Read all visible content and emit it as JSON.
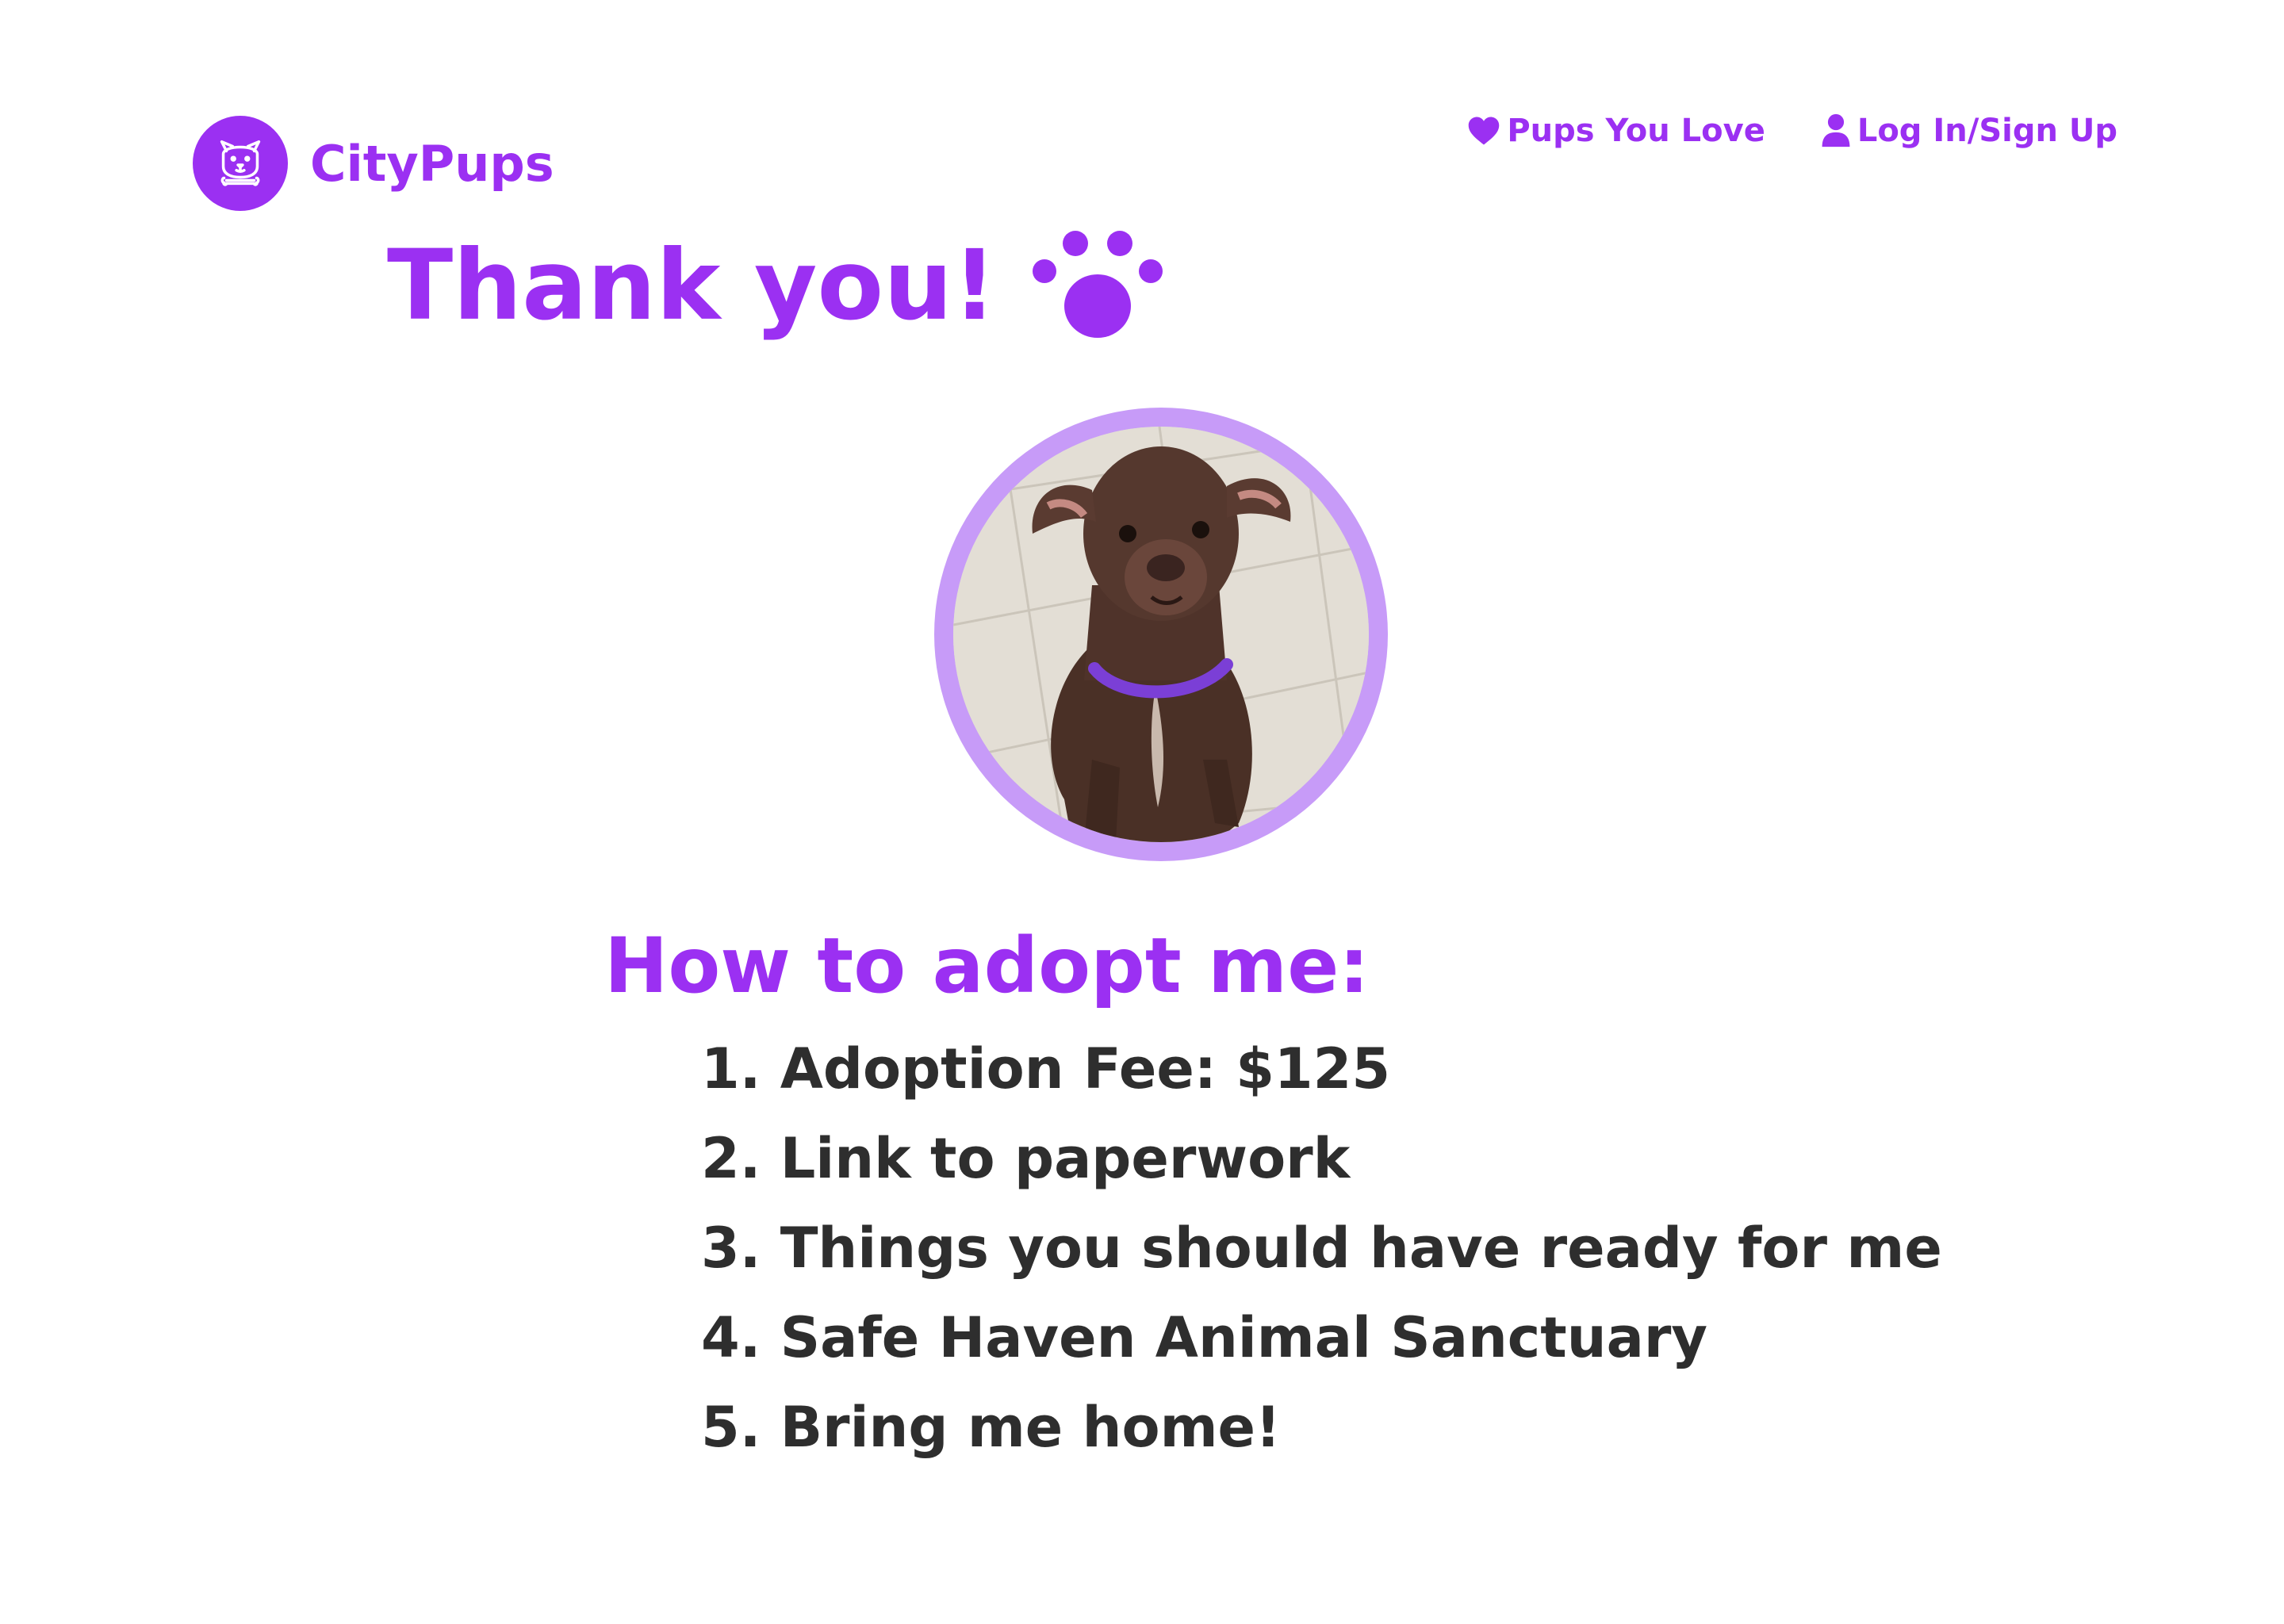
{
  "colors": {
    "accent": "#9b30f2",
    "ring": "#c79bf8",
    "text": "#2e2e2e",
    "background": "#ffffff"
  },
  "brand": {
    "name": "CityPups",
    "logo_icon": "dog-face-icon"
  },
  "nav": {
    "favorites": {
      "label": "Pups You Love",
      "icon": "heart-icon"
    },
    "account": {
      "label": "Log In/Sign Up",
      "icon": "user-icon"
    }
  },
  "heading": {
    "text": "Thank you!",
    "icon": "paw-icon"
  },
  "photo": {
    "subject": "dog-photo"
  },
  "adoption": {
    "title": "How to adopt me:",
    "steps": [
      {
        "number": "1.",
        "label": "Adoption Fee: $125"
      },
      {
        "number": "2.",
        "label": "Link to paperwork"
      },
      {
        "number": "3.",
        "label": "Things you should have ready for me"
      },
      {
        "number": "4.",
        "label": "Safe Haven Animal Sanctuary"
      },
      {
        "number": "5.",
        "label": "Bring me home!"
      }
    ]
  }
}
